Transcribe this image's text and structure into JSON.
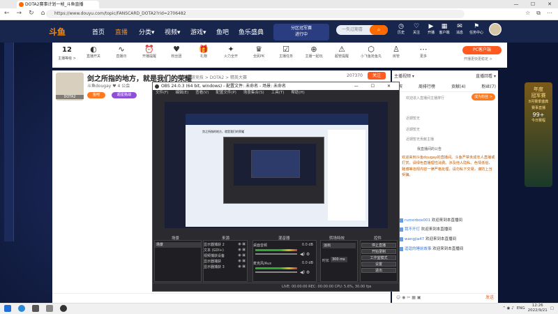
{
  "browser": {
    "tab_title": "DOTA2赛事计划一帧_斗鱼直播",
    "url": "https://www.douyu.com/topic/FANSCARD_DOTA2?rid=2706482",
    "window_controls": [
      "—",
      "☐",
      "✕"
    ],
    "nav_icons": [
      "←",
      "→",
      "↻",
      "⌂"
    ],
    "toolbar_icons": [
      "☆",
      "⧉",
      "⋯"
    ]
  },
  "site": {
    "logo": "斗鱼",
    "nav": [
      "首页",
      "直播",
      "分类▾",
      "视频▾",
      "游戏▾",
      "鱼吧",
      "鱼乐盛典"
    ],
    "promo": [
      "分区冠军赛",
      "进行中"
    ],
    "search_placeholder": "一失过期喜",
    "top_icons": [
      {
        "glyph": "◷",
        "label": "历史"
      },
      {
        "glyph": "♡",
        "label": "关注"
      },
      {
        "glyph": "▶",
        "label": "开播"
      },
      {
        "glyph": "▦",
        "label": "客户端"
      },
      {
        "glyph": "✉",
        "label": "消息"
      },
      {
        "glyph": "⚑",
        "label": "任务中心"
      }
    ]
  },
  "toolbar": {
    "level": "12",
    "level_label": "主播等级 >",
    "items": [
      {
        "glyph": "◐",
        "label": "直播开关"
      },
      {
        "glyph": "∿",
        "label": "直播日"
      },
      {
        "glyph": "⏰",
        "label": "开播提醒"
      },
      {
        "glyph": "♥",
        "label": "粉丝团"
      },
      {
        "glyph": "🎁",
        "label": "礼物"
      },
      {
        "glyph": "✦",
        "label": "火力全开"
      },
      {
        "glyph": "♛",
        "label": "全民PK"
      },
      {
        "glyph": "☑",
        "label": "主播任务"
      },
      {
        "glyph": "⊕",
        "label": "主播一起玩"
      },
      {
        "glyph": "⚠",
        "label": "超管提醒"
      },
      {
        "glyph": "⬡",
        "label": "小飞鱼抢鱼丸"
      },
      {
        "glyph": "♙",
        "label": "房管"
      },
      {
        "glyph": "⋯",
        "label": "更多"
      }
    ],
    "pc_button": "PC客户端",
    "pc_sub": "开播更快更稳定 >"
  },
  "stream": {
    "title": "剑之所指的地方，就是我们的荣耀",
    "tag": "举报  网游竞技 > DOTA2 > 精英大赛",
    "host": "斗鱼dougay  ♥ 4   公会",
    "avatar_label": "DOTA2",
    "pill1": "鱼吧",
    "pill2": "超星挑战",
    "viewers": "207370",
    "follow": "关注"
  },
  "right_panel": {
    "tabs1": [
      "主播视频 ▾",
      "直播回看 ▾"
    ],
    "tabs2": [
      "贵宾",
      "周排行榜",
      "贡献(4)",
      "粉丝(7)"
    ],
    "lines": [
      "欢迎进入直播间主播排行",
      "近期暂无",
      "近期暂无贡献主播"
    ],
    "button": "成为粉丝 >",
    "announce": "我直播间的公告",
    "welcome": "欢迎来到斗鱼dougay的直播间。斗鱼严禁未成年人直播或打赏，请绿色直播理性消费。涉及他人隐私、色情低俗、赌博等违规内容一律严格处理，请勿私下交易，谨防上当受骗。",
    "chat": [
      {
        "user": "rumorbox001",
        "text": "欢迎来到本直播间"
      },
      {
        "user": "我不开灯",
        "text": "欢迎来到本直播间"
      },
      {
        "user": "wangjia47",
        "text": "欢迎来到本直播间"
      },
      {
        "user": "逗逗的睡前故事",
        "text": "欢迎来到本直播间"
      }
    ],
    "input_icons": "☺ ◉ ✂ ▦ ▣",
    "send": "发送"
  },
  "right_ad": [
    "年度",
    "冠军赛",
    "8月赛季盛典",
    "赛事直播",
    "99+",
    "今日赛程"
  ],
  "obs": {
    "title": "OBS 24.0.3 (64 bit, windows) - 配置文件: 未命名 - 场景: 未命名",
    "menu": [
      "文件(F)",
      "编辑(E)",
      "查看(V)",
      "配置文件(P)",
      "场景集合(S)",
      "工具(T)",
      "帮助(H)"
    ],
    "inner_title": "剑之所指的地方，就是我们的荣耀",
    "docks": [
      "场景",
      "来源",
      "混音器",
      "转场特效",
      "控件"
    ],
    "scene": "场景",
    "sources": [
      "显示器捕获 2",
      "文本 (GDI+)",
      "视频捕获设备",
      "显示器捕获",
      "显示器捕获 3"
    ],
    "mixer": [
      {
        "name": "桌面音频",
        "db": "0.0 dB"
      },
      {
        "name": "麦克风/Aux",
        "db": "0.0 dB"
      }
    ],
    "transition": "淡出",
    "duration_label": "时长",
    "duration": "300 ms",
    "controls": [
      "停止直播",
      "开始录制",
      "工作室模式",
      "设置",
      "退出"
    ],
    "status": "LIVE: 00:00:00   REC: 00:00:00   CPU: 5.6%, 30.00 fps"
  },
  "taskbar": {
    "time": "12:26",
    "date": "2022/9/21",
    "lang": "ENG"
  }
}
